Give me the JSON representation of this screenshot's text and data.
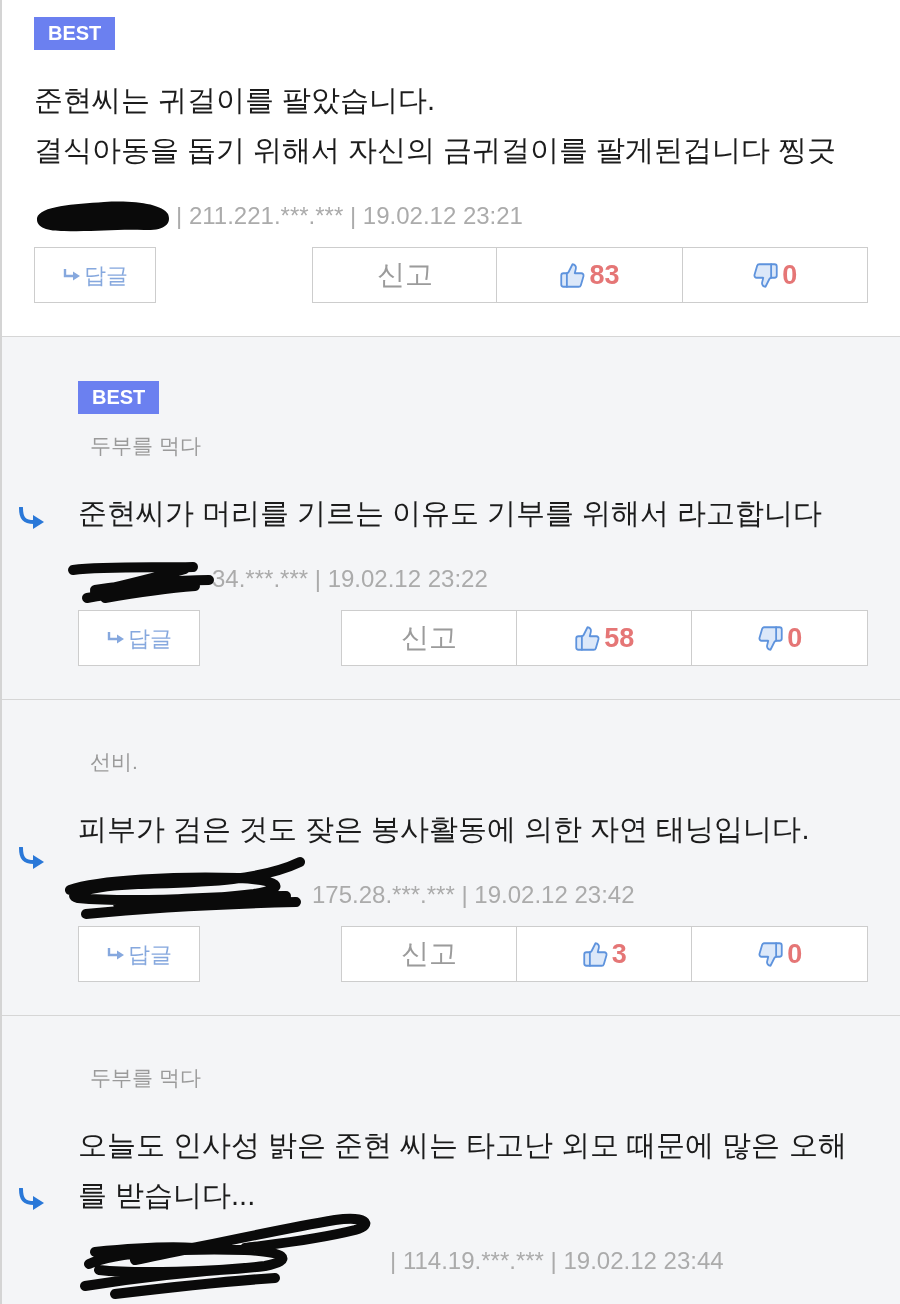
{
  "comments": [
    {
      "badge": "BEST",
      "is_reply": false,
      "author_redacted": true,
      "text": [
        "준현씨는 귀걸이를 팔았습니다.",
        "결식아동을 돕기 위해서 자신의 금귀걸이를 팔게된겁니다 찡긋"
      ],
      "meta": "| 211.221.***.*** | 19.02.12 23:21",
      "reply_button": "답글",
      "report_button": "신고",
      "likes": "83",
      "dislikes": "0"
    },
    {
      "badge": "BEST",
      "is_reply": true,
      "nickname": "두부를 먹다",
      "author_redacted": true,
      "text": [
        "준현씨가 머리를 기르는 이유도 기부를 위해서 라고합니다"
      ],
      "meta": "34.***.*** | 19.02.12 23:22",
      "reply_button": "답글",
      "report_button": "신고",
      "likes": "58",
      "dislikes": "0"
    },
    {
      "is_reply": true,
      "nickname": "선비.",
      "author_redacted": true,
      "text": [
        "피부가 검은 것도 잦은 봉사활동에 의한 자연 태닝입니다."
      ],
      "meta": "175.28.***.*** | 19.02.12 23:42",
      "reply_button": "답글",
      "report_button": "신고",
      "likes": "3",
      "dislikes": "0"
    },
    {
      "is_reply": true,
      "nickname": "두부를 먹다",
      "author_redacted": true,
      "text": [
        "오늘도 인사성 밝은 준현 씨는 타고난 외모 때문에 많은 오해를 받습니다..."
      ],
      "meta": "| 114.19.***.*** | 19.02.12 23:44"
    }
  ]
}
